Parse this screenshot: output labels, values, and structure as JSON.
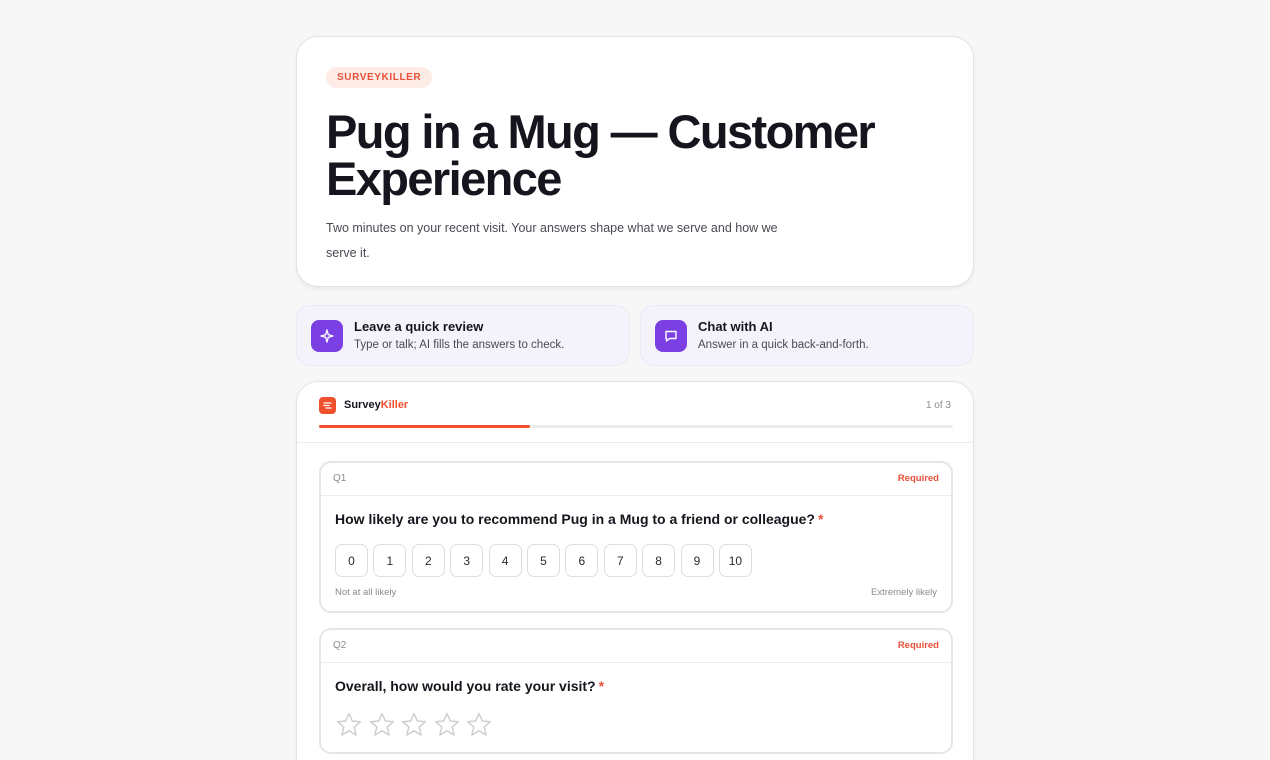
{
  "hero": {
    "brand": "SURVEYKILLER",
    "title": "Pug in a Mug — Customer Experience",
    "description": "Two minutes on your recent visit. Your answers shape what we serve and how we serve it."
  },
  "options": [
    {
      "title": "Leave a quick review",
      "subtitle": "Type or talk; AI fills the answers to check.",
      "icon": "sparkle-icon"
    },
    {
      "title": "Chat with AI",
      "subtitle": "Answer in a quick back-and-forth.",
      "icon": "chat-bubble-icon"
    }
  ],
  "survey": {
    "logo_main": "Survey",
    "logo_accent": "Killer",
    "page_count": "1 of 3",
    "progress_fraction": 0.333,
    "questions": [
      {
        "number": "Q1",
        "required_label": "Required",
        "title": "How likely are you to recommend Pug in a Mug to a friend or colleague?",
        "required_marker": "*",
        "scale": [
          "0",
          "1",
          "2",
          "3",
          "4",
          "5",
          "6",
          "7",
          "8",
          "9",
          "10"
        ],
        "low_label": "Not at all likely",
        "high_label": "Extremely likely"
      },
      {
        "number": "Q2",
        "required_label": "Required",
        "title": "Overall, how would you rate your visit?",
        "required_marker": "*",
        "star_count": 5
      }
    ]
  },
  "colors": {
    "accent": "#f0502e",
    "purple": "#7b3fe4"
  }
}
